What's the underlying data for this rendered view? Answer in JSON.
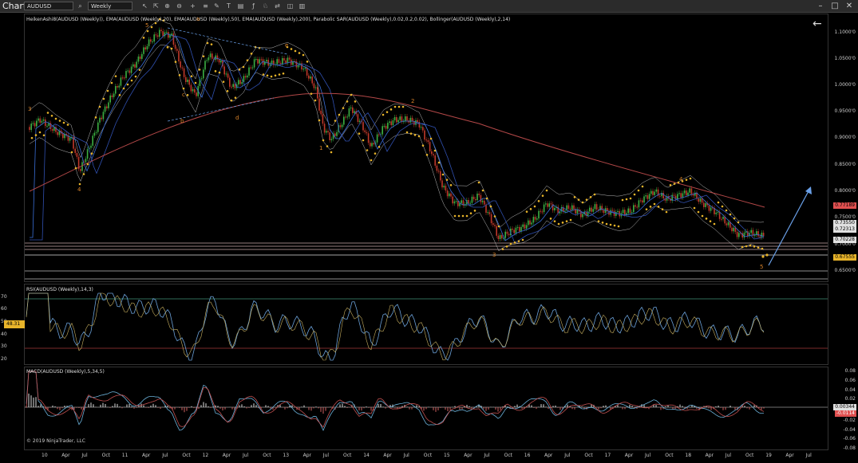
{
  "window": {
    "title": "Chart",
    "minimize": "–",
    "maximize": "□",
    "close": "✕"
  },
  "toolbar": {
    "instrument": "AUDUSD",
    "interval": "Weekly",
    "icons": [
      "search-icon",
      "pointer-icon",
      "zoom-in-icon",
      "zoom-out-icon",
      "crosshair-icon",
      "cursor-icon",
      "properties-icon",
      "drawing-icon",
      "text-icon",
      "data-box-icon",
      "indicators-icon",
      "strategies-icon",
      "chart-trader-icon",
      "screenshot-icon",
      "share-icon",
      "template-icon"
    ]
  },
  "panels": {
    "price": {
      "title": "HeikenAshi8(AUDUSD (Weekly)), EMA(AUDUSD (Weekly),20), EMA(AUDUSD (Weekly),50), EMA(AUDUSD (Weekly),200), Parabolic SAR(AUDUSD (Weekly),0.02,0.2,0.02), Bollinger(AUDUSD (Weekly),2,14)",
      "y_labels": [
        "1.1000'0",
        "1.0500'0",
        "1.0000'0",
        "0.9500'0",
        "0.9000'0",
        "0.8500'0",
        "0.8000'0",
        "0.7500'0",
        "0.7000'0",
        "0.6500'0"
      ],
      "price_tags": [
        {
          "text": "0.77189",
          "color": "#e05050"
        },
        {
          "text": "0.73550",
          "color": "#e0e0e0"
        },
        {
          "text": "0.72313",
          "color": "#e0e0e0"
        },
        {
          "text": "0.70228",
          "color": "#e0e0e0"
        },
        {
          "text": "0.67555",
          "color": "#e8b42a"
        }
      ],
      "wave_labels": [
        {
          "text": "3"
        },
        {
          "text": "4"
        },
        {
          "text": "5"
        },
        {
          "text": "a"
        },
        {
          "text": "b"
        },
        {
          "text": "c"
        },
        {
          "text": "d"
        },
        {
          "text": "e"
        },
        {
          "text": "1"
        },
        {
          "text": "2"
        },
        {
          "text": "3"
        },
        {
          "text": "4"
        },
        {
          "text": "5"
        }
      ]
    },
    "rsi": {
      "title": "RSI(AUDUSD (Weekly),14,3)",
      "y_labels": [
        "70",
        "60",
        "50",
        "40",
        "30",
        "20"
      ],
      "current": "48.31"
    },
    "macd": {
      "title": "MACD(AUDUSD (Weekly),5,34,5)",
      "y_labels": [
        "0.08",
        "0.06",
        "0.04",
        "0.02",
        "-0.02",
        "-0.04",
        "-0.06",
        "-0.08"
      ],
      "tags": [
        {
          "text": "0.00344",
          "color": "#e0e0e0"
        },
        {
          "text": "-0.0114",
          "color": "#e05050"
        }
      ]
    }
  },
  "x_labels": [
    "10",
    "Apr",
    "Jul",
    "Oct",
    "11",
    "Apr",
    "Jul",
    "Oct",
    "12",
    "Apr",
    "Jul",
    "Oct",
    "13",
    "Apr",
    "Jul",
    "Oct",
    "14",
    "Apr",
    "Jul",
    "Oct",
    "15",
    "Apr",
    "Jul",
    "Oct",
    "16",
    "Apr",
    "Jul",
    "Oct",
    "17",
    "Apr",
    "Jul",
    "Oct",
    "18",
    "Apr",
    "Jul",
    "Oct",
    "19",
    "Apr",
    "Jul"
  ],
  "copyright": "© 2019 NinjaTrader, LLC",
  "colors": {
    "ema20": "#3a6fd8",
    "ema200": "#b44848",
    "sar": "#e8b42a",
    "bull": "#3cb043",
    "bear": "#c0392b",
    "rsi": "#6aa0d8",
    "macd": "#6ab0d8",
    "signal": "#c05050",
    "forecast": "#6aa0e8"
  }
}
